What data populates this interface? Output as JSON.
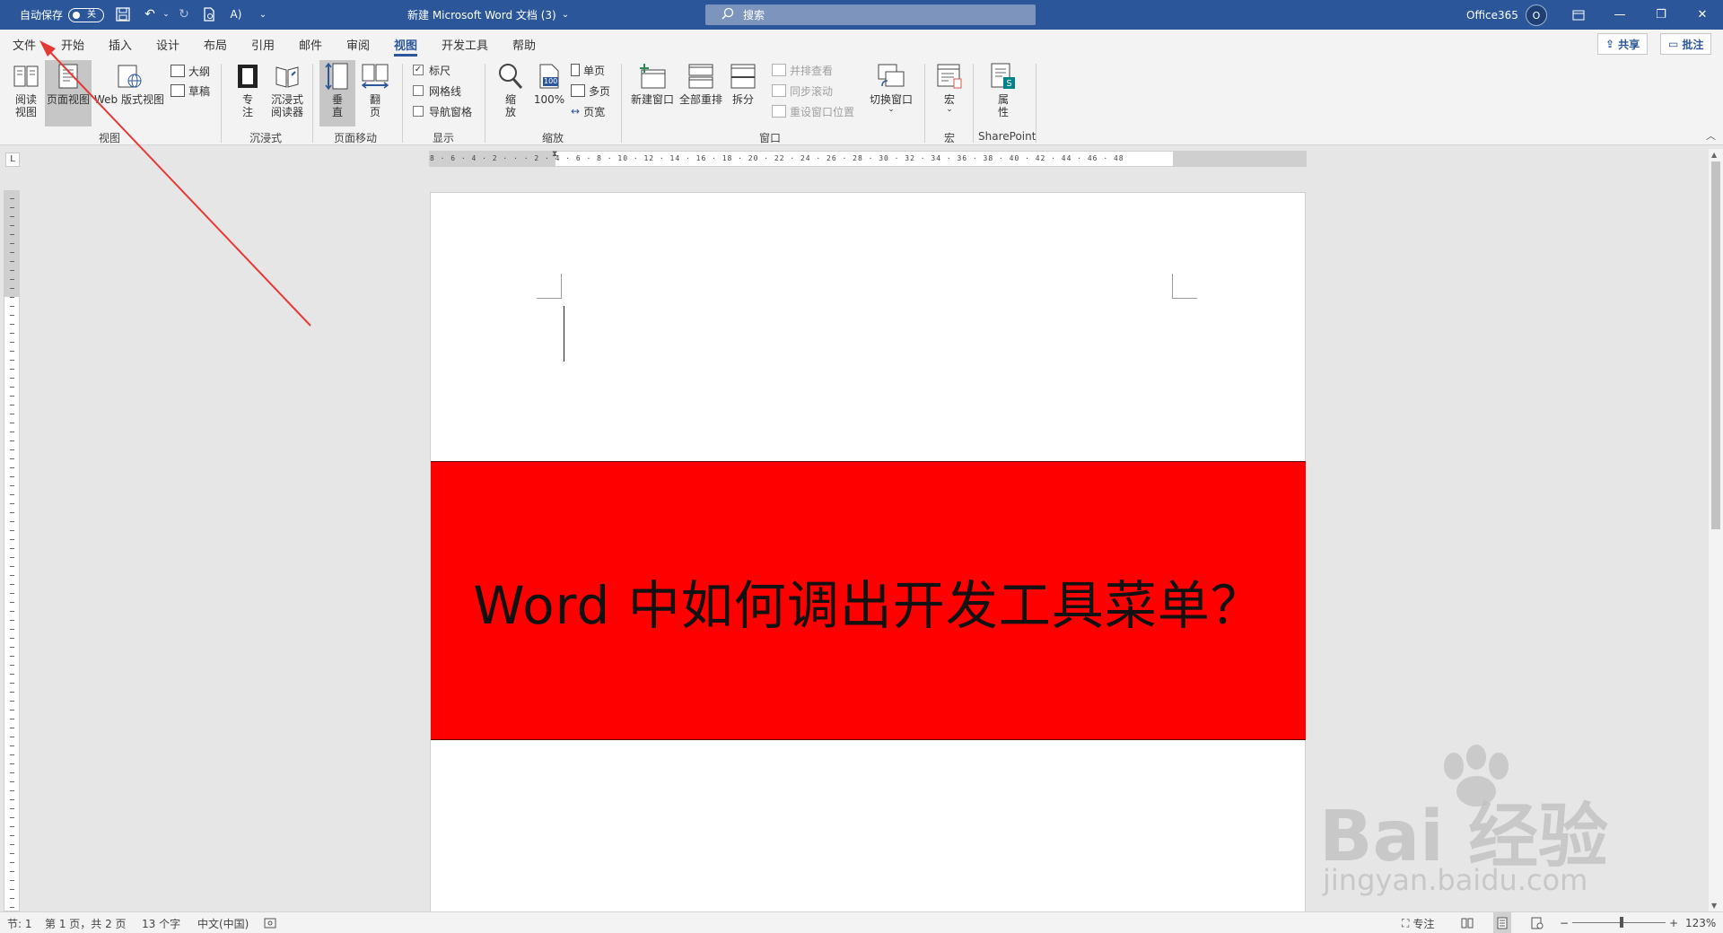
{
  "titlebar": {
    "autosave_label": "自动保存",
    "autosave_state": "关",
    "doc_title": "新建 Microsoft Word 文档 (3)",
    "title_caret": "⌄",
    "search_placeholder": "搜索",
    "account": "Office365",
    "avatar_initial": "O"
  },
  "tabs": [
    "文件",
    "开始",
    "插入",
    "设计",
    "布局",
    "引用",
    "邮件",
    "审阅",
    "视图",
    "开发工具",
    "帮助"
  ],
  "active_tab": "视图",
  "actions": {
    "share": "共享",
    "comment": "批注"
  },
  "ribbon": {
    "views": {
      "read_mode": "阅读\n视图",
      "print_layout": "页面视图",
      "web_layout": "Web 版式视图",
      "outline": "大纲",
      "draft": "草稿",
      "group": "视图"
    },
    "immersive": {
      "focus": "专\n注",
      "immersive_reader": "沉浸式\n阅读器",
      "group": "沉浸式"
    },
    "page_movement": {
      "vertical": "垂\n直",
      "side_to_side": "翻\n页",
      "group": "页面移动"
    },
    "show": {
      "ruler": "标尺",
      "gridlines": "网格线",
      "nav_pane": "导航窗格",
      "group": "显示",
      "ruler_checked": true
    },
    "zoom": {
      "zoom": "缩\n放",
      "hundred": "100%",
      "hundred_icon": "100",
      "one_page": "单页",
      "multiple_pages": "多页",
      "page_width": "页宽",
      "group": "缩放"
    },
    "window": {
      "new_window": "新建窗口",
      "arrange_all": "全部重排",
      "split": "拆分",
      "side_by_side": "并排查看",
      "sync_scroll": "同步滚动",
      "reset_pos": "重设窗口位置",
      "switch_windows": "切换窗口",
      "group": "窗口"
    },
    "macros": {
      "macros": "宏",
      "group": "宏"
    },
    "sharepoint": {
      "properties": "属\n性",
      "group": "SharePoint"
    }
  },
  "ruler_corner": "L",
  "ruler_ticks": "8 · 6 · 4 · 2 · ·   · 2 · 4 · 6 · 8 · 10 · 12 · 14 · 16 · 18 · 20 · 22 · 24 · 26 · 28 · 30 · 32 · 34 · 36 · 38 · 40 · 42 · 44 · 46 · 48",
  "document": {
    "banner_text": "Word 中如何调出开发工具菜单？",
    "banner_color": "#ff0000"
  },
  "statusbar": {
    "section": "节: 1",
    "page": "第 1 页，共 2 页",
    "words": "13 个字",
    "language": "中文(中国)",
    "focus": "专注",
    "zoom_level": "123%",
    "zoom_minus": "−",
    "zoom_plus": "+"
  },
  "watermark": {
    "main": "Bai 经验",
    "sub": "jingyan.baidu.com"
  },
  "colors": {
    "titlebar": "#2b579a",
    "ribbon": "#f3f3f3",
    "annotation_arrow": "#e53935"
  }
}
